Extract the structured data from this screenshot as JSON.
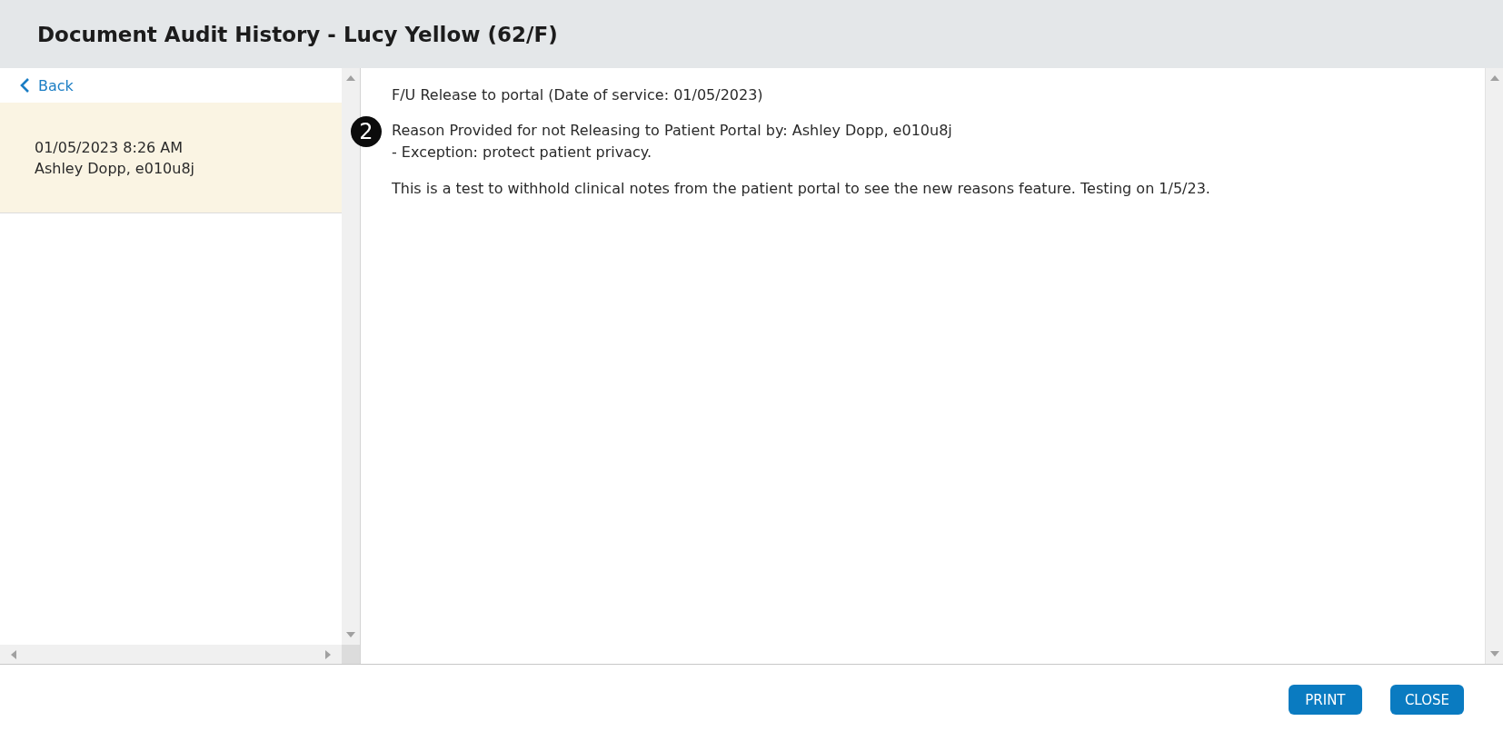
{
  "window": {
    "title": "Document Audit History - Lucy Yellow (62/F)"
  },
  "sidebar": {
    "back_link": "Back",
    "items": [
      {
        "date": "01/05/2023 8:26 AM",
        "user": "Ashley Dopp, e010u8j",
        "selected": true
      }
    ]
  },
  "content": {
    "heading": "F/U Release to portal (Date of service: 01/05/2023)",
    "reason": {
      "marker": "2",
      "lines": [
        "Reason Provided for not Releasing to Patient Portal by: Ashley Dopp, e010u8j",
        "- Exception: protect patient privacy."
      ]
    },
    "note": "This is a test to withhold clinical notes from the patient portal to see the new reasons feature. Testing on 1/5/23."
  },
  "buttons": [
    {
      "label": "PRINT"
    },
    {
      "label": "CLOSE"
    }
  ]
}
